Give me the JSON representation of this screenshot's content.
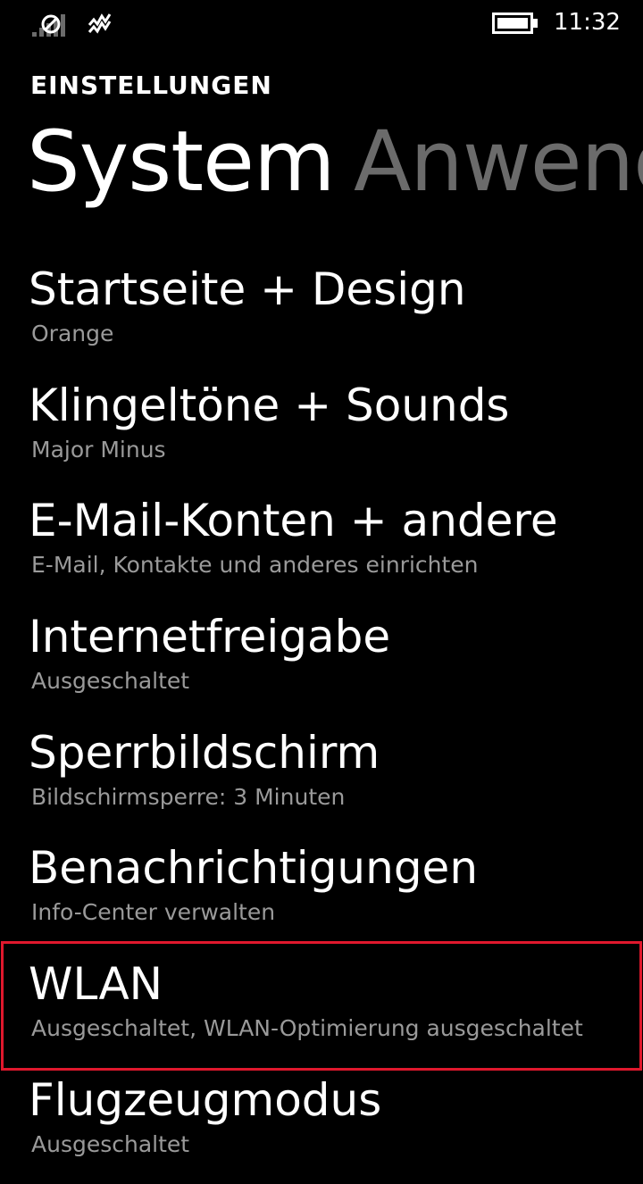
{
  "status_bar": {
    "time": "11:32",
    "icons": [
      "signal-icon",
      "vibrate-icon",
      "battery-icon"
    ]
  },
  "header": {
    "app_title": "EINSTELLUNGEN"
  },
  "pivot": {
    "active": "System",
    "next": "Anwend"
  },
  "settings": [
    {
      "title": "Startseite + Design",
      "subtitle": "Orange"
    },
    {
      "title": "Klingeltöne + Sounds",
      "subtitle": "Major Minus"
    },
    {
      "title": "E-Mail-Konten + andere",
      "subtitle": "E-Mail, Kontakte und anderes einrichten"
    },
    {
      "title": "Internetfreigabe",
      "subtitle": "Ausgeschaltet"
    },
    {
      "title": "Sperrbildschirm",
      "subtitle": "Bildschirmsperre: 3 Minuten"
    },
    {
      "title": "Benachrichtigungen",
      "subtitle": "Info-Center verwalten"
    },
    {
      "title": "WLAN",
      "subtitle": "Ausgeschaltet, WLAN-Optimierung ausgeschaltet"
    },
    {
      "title": "Flugzeugmodus",
      "subtitle": "Ausgeschaltet"
    }
  ],
  "colors": {
    "background": "#000000",
    "text": "#ffffff",
    "subtext": "#9a9a9a",
    "inactive_pivot": "#6b6b6b",
    "highlight": "#e0182d"
  }
}
